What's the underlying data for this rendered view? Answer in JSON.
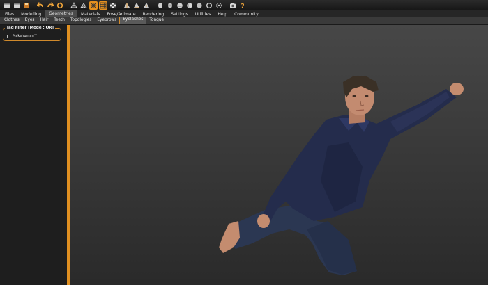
{
  "menu": [
    {
      "label": "Files"
    },
    {
      "label": "Modelling"
    },
    {
      "label": "Geometries",
      "active": true
    },
    {
      "label": "Materials"
    },
    {
      "label": "Pose/Animate"
    },
    {
      "label": "Rendering"
    },
    {
      "label": "Settings"
    },
    {
      "label": "Utilities"
    },
    {
      "label": "Help"
    },
    {
      "label": "Community"
    }
  ],
  "subtabs": [
    {
      "label": "Clothes"
    },
    {
      "label": "Eyes"
    },
    {
      "label": "Hair"
    },
    {
      "label": "Teeth"
    },
    {
      "label": "Topologies"
    },
    {
      "label": "Eyebrows"
    },
    {
      "label": "Eyelashes",
      "active": true
    },
    {
      "label": "Tongue"
    }
  ],
  "filter": {
    "title": "Tag Filter [Mode : OR]",
    "item_label": "Makehuman™",
    "checked": false
  },
  "colors": {
    "accent": "#e5901f",
    "panel": "#1e1e1e",
    "toolbar": "#1c1c1c",
    "shirt": "#232b4b",
    "jeans": "#2a3650",
    "skin": "#c88f73"
  },
  "toolbar_icons": [
    "window-icon",
    "window-icon",
    "save-icon",
    "undo-icon",
    "redo-icon",
    "reset-icon",
    "wireframe-icon",
    "smooth-icon",
    "grid-icon",
    "grid-large-icon",
    "checker-icon",
    "front-view-icon",
    "side-view-icon",
    "top-view-icon",
    "head-view-icon",
    "body-view-icon",
    "sphere-view-icon",
    "sphere-alt-icon",
    "sphere-small-icon",
    "ring-icon",
    "reset-camera-icon",
    "camera-icon",
    "help-icon"
  ]
}
